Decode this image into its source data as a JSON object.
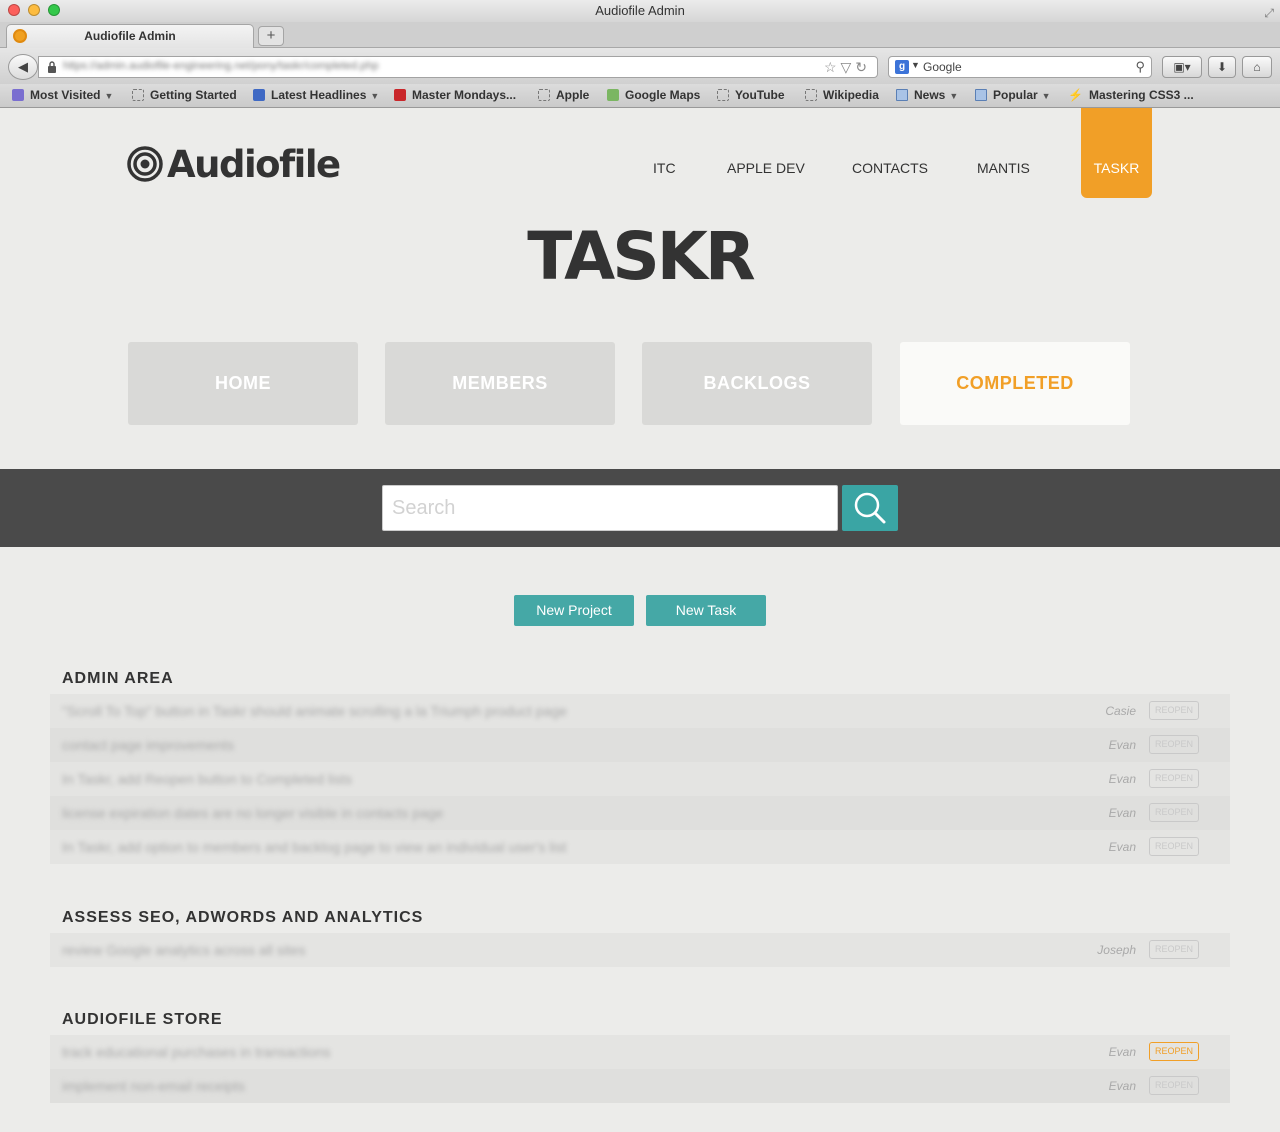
{
  "window": {
    "title": "Audiofile Admin"
  },
  "tab": {
    "title": "Audiofile Admin",
    "new_tab_label": "+"
  },
  "address": {
    "url": "https://admin.audiofile-engineering.net/pony/taskr/completed.php"
  },
  "search_engine": {
    "placeholder": "Google"
  },
  "bookmarks": [
    {
      "label": "Most Visited",
      "icon": "purple",
      "caret": true
    },
    {
      "label": "Getting Started",
      "icon": "page",
      "caret": false
    },
    {
      "label": "Latest Headlines",
      "icon": "rss",
      "caret": true
    },
    {
      "label": "Master Mondays...",
      "icon": "red",
      "caret": false
    },
    {
      "label": "Apple",
      "icon": "page",
      "caret": false
    },
    {
      "label": "Google Maps",
      "icon": "map",
      "caret": false
    },
    {
      "label": "YouTube",
      "icon": "page",
      "caret": false
    },
    {
      "label": "Wikipedia",
      "icon": "page",
      "caret": false
    },
    {
      "label": "News",
      "icon": "folder",
      "caret": true
    },
    {
      "label": "Popular",
      "icon": "folder",
      "caret": true
    },
    {
      "label": "Mastering CSS3 ...",
      "icon": "spark",
      "caret": false
    }
  ],
  "site": {
    "logo_text": "Audiofile",
    "nav": [
      "ITC",
      "APPLE DEV",
      "CONTACTS",
      "MANTIS"
    ],
    "nav_active": "TASKR",
    "page_title": "TASKR",
    "sections": [
      "HOME",
      "MEMBERS",
      "BACKLOGS",
      "COMPLETED"
    ],
    "search_placeholder": "Search",
    "new_project_label": "New Project",
    "new_task_label": "New Task",
    "accent_color": "#f19f27",
    "teal_color": "#3aa5a4"
  },
  "projects": [
    {
      "name": "ADMIN AREA",
      "tasks": [
        {
          "text": "\"Scroll To Top\" button in Taskr should animate scrolling a la Triumph product page",
          "assignee": "Casie",
          "action": "REOPEN",
          "highlight": false
        },
        {
          "text": "contact page improvements",
          "assignee": "Evan",
          "action": "REOPEN",
          "highlight": false
        },
        {
          "text": "In Taskr, add Reopen button to Completed lists",
          "assignee": "Evan",
          "action": "REOPEN",
          "highlight": false
        },
        {
          "text": "license expiration dates are no longer visible in contacts page",
          "assignee": "Evan",
          "action": "REOPEN",
          "highlight": false
        },
        {
          "text": "In Taskr, add option to members and backlog page to view an individual user's list",
          "assignee": "Evan",
          "action": "REOPEN",
          "highlight": false
        }
      ]
    },
    {
      "name": "ASSESS SEO, ADWORDS AND ANALYTICS",
      "tasks": [
        {
          "text": "review Google analytics across all sites",
          "assignee": "Joseph",
          "action": "REOPEN",
          "highlight": false
        }
      ]
    },
    {
      "name": "AUDIOFILE STORE",
      "tasks": [
        {
          "text": "track educational purchases in transactions",
          "assignee": "Evan",
          "action": "REOPEN",
          "highlight": true
        },
        {
          "text": "implement non-email receipts",
          "assignee": "Evan",
          "action": "REOPEN",
          "highlight": false
        }
      ]
    }
  ]
}
